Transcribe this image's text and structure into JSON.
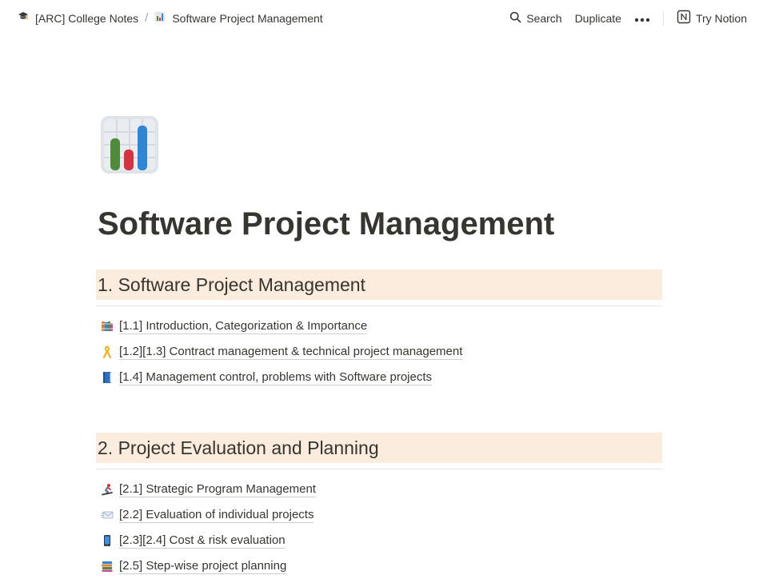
{
  "breadcrumb": {
    "items": [
      {
        "label": "[ARC] College Notes",
        "icon": "graduation-cap-icon"
      },
      {
        "label": "Software Project Management",
        "icon": "bar-chart-icon"
      }
    ],
    "separator": "/"
  },
  "topbar": {
    "search_label": "Search",
    "duplicate_label": "Duplicate",
    "more_label": "•••",
    "try_label": "Try Notion"
  },
  "page": {
    "icon": "bar-chart-icon",
    "title": "Software Project Management"
  },
  "sections": [
    {
      "heading": "1. Software Project Management",
      "links": [
        {
          "label": "[1.1] Introduction, Categorization & Importance",
          "icon": "books-icon"
        },
        {
          "label": "[1.2][1.3] Contract management & technical project management",
          "icon": "ribbon-icon"
        },
        {
          "label": "[1.4] Management control, problems with Software projects",
          "icon": "blue-book-icon"
        }
      ]
    },
    {
      "heading": "2. Project Evaluation and Planning",
      "links": [
        {
          "label": "[2.1] Strategic Program Management",
          "icon": "snowboarder-icon"
        },
        {
          "label": "[2.2] Evaluation of individual projects",
          "icon": "envelope-icon"
        },
        {
          "label": "[2.3][2.4] Cost & risk evaluation",
          "icon": "mobile-phone-icon"
        },
        {
          "label": "[2.5] Step-wise project planning",
          "icon": "books-stack-icon"
        }
      ]
    }
  ],
  "colors": {
    "heading_background": "#fbecdd",
    "text": "#37352f"
  }
}
